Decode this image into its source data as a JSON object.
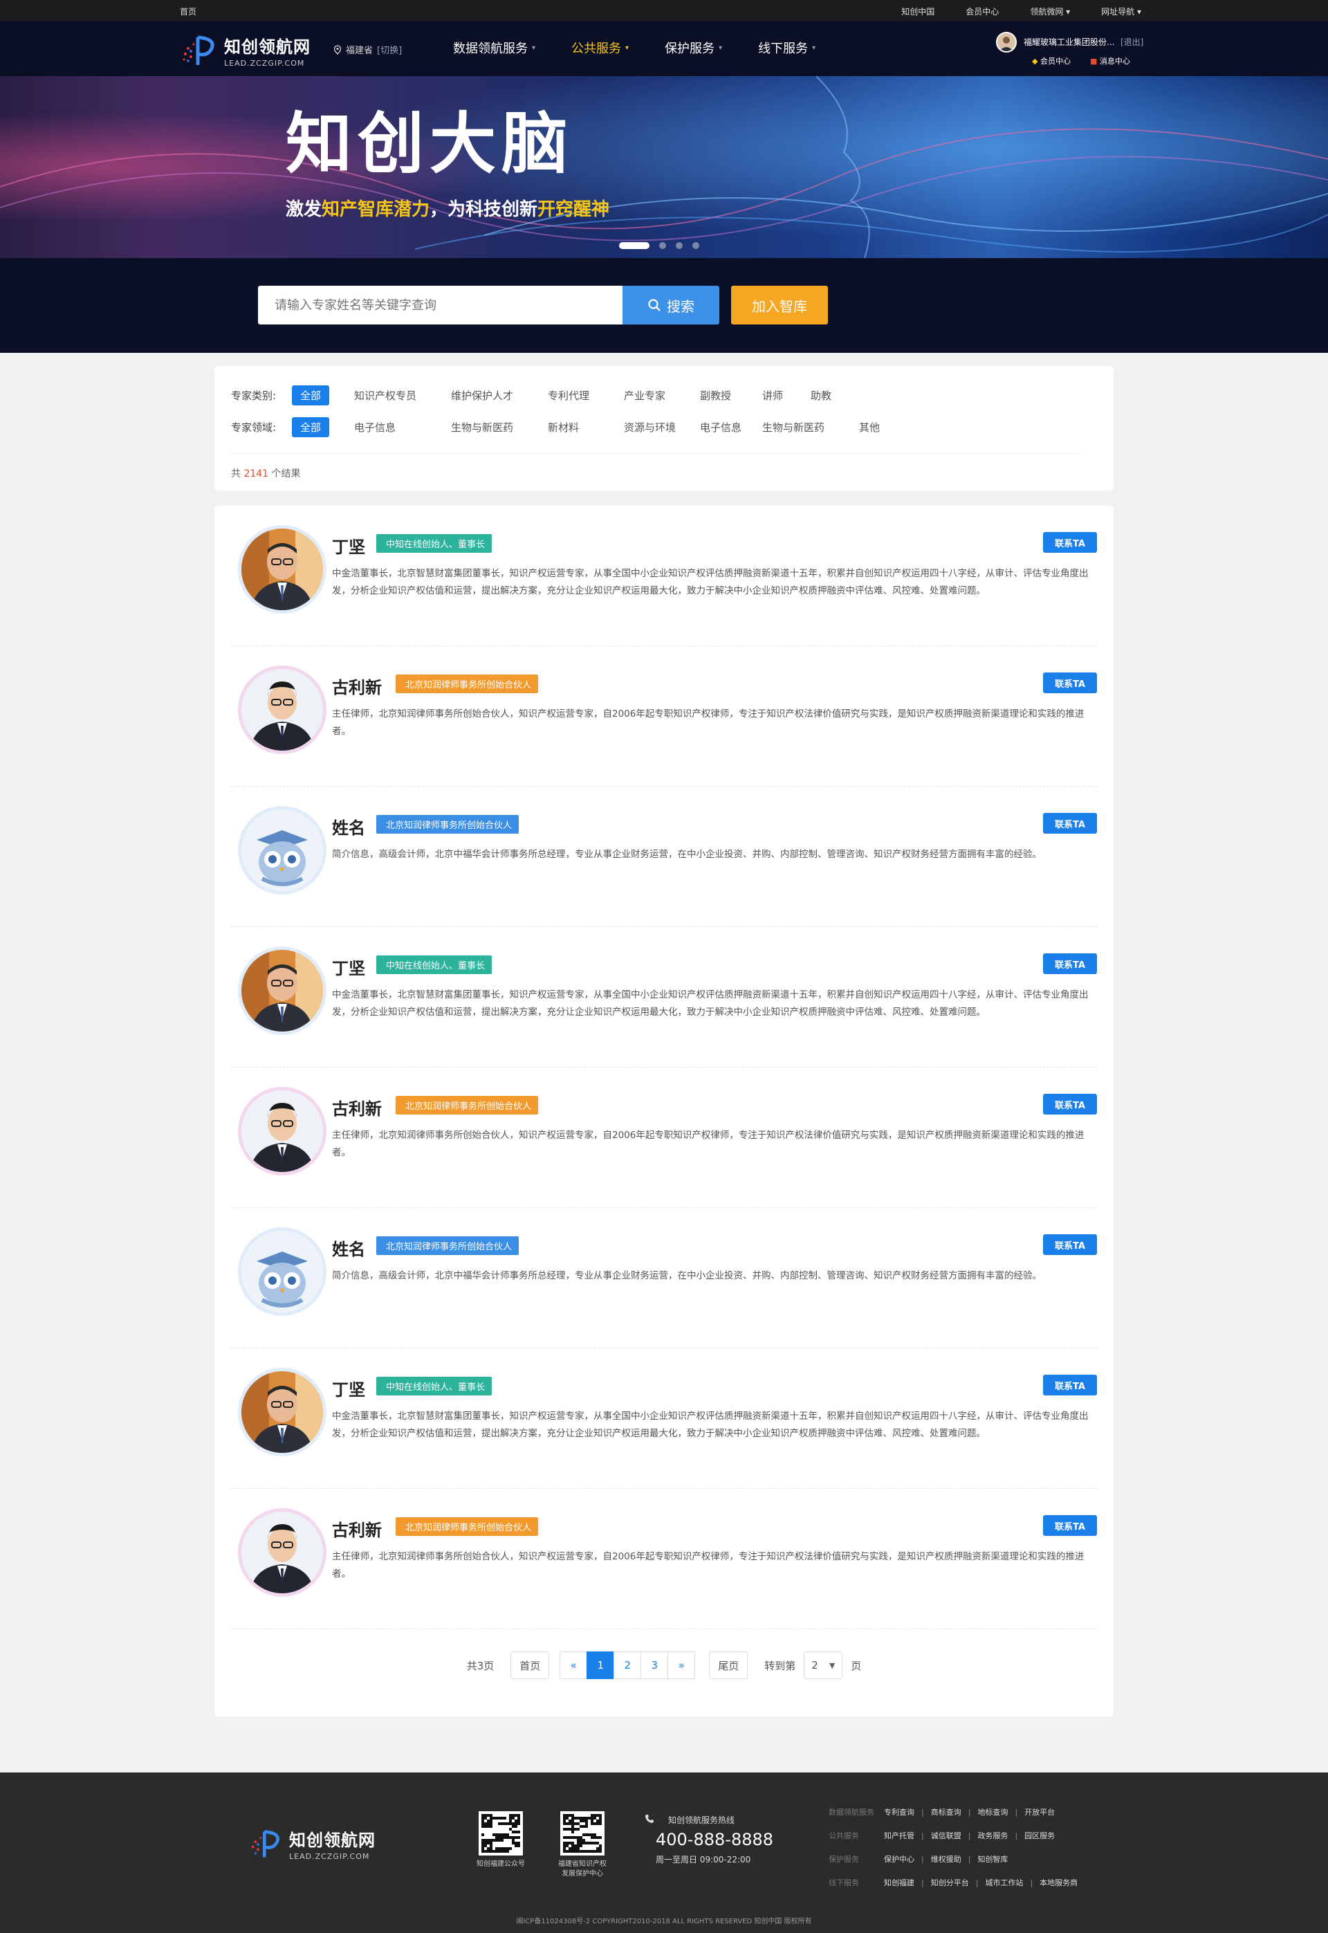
{
  "topbar": {
    "home": "首页",
    "links": [
      "知创中国",
      "会员中心",
      "领航微网 ▾",
      "网址导航 ▾"
    ]
  },
  "header": {
    "logo_title": "知创领航网",
    "logo_sub": "LEAD.ZCZGIP.COM",
    "region": "福建省",
    "region_switch": "[切换]",
    "menu": [
      {
        "label": "数据领航服务",
        "active": false
      },
      {
        "label": "公共服务",
        "active": true
      },
      {
        "label": "保护服务",
        "active": false
      },
      {
        "label": "线下服务",
        "active": false
      }
    ],
    "user_name": "福耀玻璃工业集团股份...",
    "logout": "[退出]",
    "member_center": "会员中心",
    "messages": "消息中心"
  },
  "banner": {
    "title": "知创大脑",
    "sub_1": "激发",
    "sub_hl_1": "知产智库潜力",
    "sub_2": "，为科技创新",
    "sub_hl_2": "开窍醒神"
  },
  "search": {
    "placeholder": "请输入专家姓名等关键字查询",
    "button": "搜索",
    "join": "加入智库"
  },
  "filter": {
    "category_label": "专家类别:",
    "category_all": "全部",
    "categories": [
      "知识产权专员",
      "维护保护人才",
      "专利代理",
      "产业专家",
      "副教授",
      "讲师",
      "助教"
    ],
    "field_label": "专家领域:",
    "field_all": "全部",
    "fields": [
      "电子信息",
      "生物与新医药",
      "新材料",
      "资源与环境",
      "电子信息",
      "生物与新医药",
      "其他"
    ],
    "total_prefix": "共",
    "total": "2141",
    "total_suffix": "个结果"
  },
  "experts": [
    {
      "name": "丁坚",
      "tag": "中知在线创始人、董事长",
      "tag_color": "#2bb39b",
      "desc": "中金浩董事长，北京智慧财富集团董事长，知识产权运营专家，从事全国中小企业知识产权评估质押融资新渠道十五年，积累并自创知识产权运用四十八字经，从审计、评估专业角度出发，分析企业知识产权估值和运营，提出解决方案，充分让企业知识产权运用最大化，致力于解决中小企业知识产权质押融资中评估难、风控难、处置难问题。",
      "button": "联系TA",
      "avatar": "man-glasses"
    },
    {
      "name": "古利新",
      "tag": "北京知润律师事务所创始合伙人",
      "tag_color": "#f29a2e",
      "desc": "主任律师，北京知润律师事务所创始合伙人，知识产权运营专家，自2006年起专职知识产权律师，专注于知识产权法律价值研究与实践，是知识产权质押融资新渠道理论和实践的推进者。",
      "button": "联系TA",
      "avatar": "man-suit"
    },
    {
      "name": "姓名",
      "tag": "北京知润律师事务所创始合伙人",
      "tag_color": "#3a8ee6",
      "desc": "简介信息，高级会计师，北京中福华会计师事务所总经理，专业从事企业财务运营，在中小企业投资、并购、内部控制、管理咨询、知识产权财务经营方面拥有丰富的经验。",
      "button": "联系TA",
      "avatar": "owl"
    },
    {
      "name": "丁坚",
      "tag": "中知在线创始人、董事长",
      "tag_color": "#2bb39b",
      "desc": "中金浩董事长，北京智慧财富集团董事长，知识产权运营专家，从事全国中小企业知识产权评估质押融资新渠道十五年，积累并自创知识产权运用四十八字经，从审计、评估专业角度出发，分析企业知识产权估值和运营，提出解决方案，充分让企业知识产权运用最大化，致力于解决中小企业知识产权质押融资中评估难、风控难、处置难问题。",
      "button": "联系TA",
      "avatar": "man-glasses"
    },
    {
      "name": "古利新",
      "tag": "北京知润律师事务所创始合伙人",
      "tag_color": "#f29a2e",
      "desc": "主任律师，北京知润律师事务所创始合伙人，知识产权运营专家，自2006年起专职知识产权律师，专注于知识产权法律价值研究与实践，是知识产权质押融资新渠道理论和实践的推进者。",
      "button": "联系TA",
      "avatar": "man-suit"
    },
    {
      "name": "姓名",
      "tag": "北京知润律师事务所创始合伙人",
      "tag_color": "#3a8ee6",
      "desc": "简介信息，高级会计师，北京中福华会计师事务所总经理，专业从事企业财务运营，在中小企业投资、并购、内部控制、管理咨询、知识产权财务经营方面拥有丰富的经验。",
      "button": "联系TA",
      "avatar": "owl"
    },
    {
      "name": "丁坚",
      "tag": "中知在线创始人、董事长",
      "tag_color": "#2bb39b",
      "desc": "中金浩董事长，北京智慧财富集团董事长，知识产权运营专家，从事全国中小企业知识产权评估质押融资新渠道十五年，积累并自创知识产权运用四十八字经，从审计、评估专业角度出发，分析企业知识产权估值和运营，提出解决方案，充分让企业知识产权运用最大化，致力于解决中小企业知识产权质押融资中评估难、风控难、处置难问题。",
      "button": "联系TA",
      "avatar": "man-glasses"
    },
    {
      "name": "古利新",
      "tag": "北京知润律师事务所创始合伙人",
      "tag_color": "#f29a2e",
      "desc": "主任律师，北京知润律师事务所创始合伙人，知识产权运营专家，自2006年起专职知识产权律师，专注于知识产权法律价值研究与实践，是知识产权质押融资新渠道理论和实践的推进者。",
      "button": "联系TA",
      "avatar": "man-suit"
    }
  ],
  "pager": {
    "total_pages": "共3页",
    "first": "首页",
    "prev": "«",
    "pages": [
      "1",
      "2",
      "3"
    ],
    "current": "1",
    "next": "»",
    "last": "尾页",
    "goto_prefix": "转到第",
    "goto_value": "2",
    "goto_suffix": "页"
  },
  "footer": {
    "logo_title": "知创领航网",
    "logo_sub": "LEAD.ZCZGIP.COM",
    "qr1_caption": "知创福建公众号",
    "qr2_caption": "福建省知识产权\n发展保护中心",
    "hotline_title": "知创领航服务热线",
    "hotline_number": "400-888-8888",
    "hotline_hours": "周一至周日 09:00-22:00",
    "link_rows": [
      {
        "cat": "数据领航服务",
        "links": [
          "专利查询",
          "商标查询",
          "地标查询",
          "开放平台"
        ]
      },
      {
        "cat": "公共服务",
        "links": [
          "知产托管",
          "诚信联盟",
          "政务服务",
          "园区服务"
        ]
      },
      {
        "cat": "保护服务",
        "links": [
          "保护中心",
          "维权援助",
          "知创智库"
        ]
      },
      {
        "cat": "线下服务",
        "links": [
          "知创福建",
          "知创分平台",
          "城市工作站",
          "本地服务商"
        ]
      }
    ],
    "copyright": "闽ICP备11024308号-2 COPYRIGHT2010-2018 ALL RIGHTS RESERVED 知创中国 版权所有"
  },
  "colors": {
    "accent": "#1a7fe8",
    "nav_bg": "#0b0f26",
    "highlight": "#f5c518",
    "join": "#f5a623",
    "footer_bg": "#2b2b2b"
  }
}
